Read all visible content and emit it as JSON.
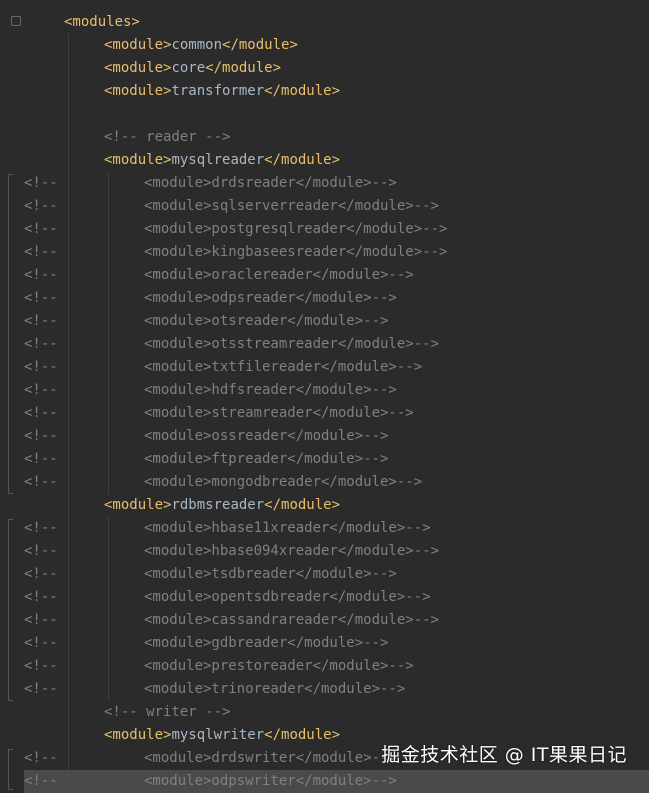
{
  "editor": {
    "lines": [
      {
        "indent": 1,
        "type": "tag",
        "open": "<modules>",
        "name": "",
        "close": ""
      },
      {
        "indent": 2,
        "type": "tag",
        "open": "<module>",
        "name": "common",
        "close": "</module>"
      },
      {
        "indent": 2,
        "type": "tag",
        "open": "<module>",
        "name": "core",
        "close": "</module>"
      },
      {
        "indent": 2,
        "type": "tag",
        "open": "<module>",
        "name": "transformer",
        "close": "</module>"
      },
      {
        "indent": 0,
        "type": "blank"
      },
      {
        "indent": 2,
        "type": "comment",
        "text": "<!-- reader -->"
      },
      {
        "indent": 2,
        "type": "tag",
        "open": "<module>",
        "name": "mysqlreader",
        "close": "</module>"
      },
      {
        "type": "lc",
        "text": "<module>drdsreader</module>-->"
      },
      {
        "type": "lc",
        "text": "<module>sqlserverreader</module>-->"
      },
      {
        "type": "lc",
        "text": "<module>postgresqlreader</module>-->"
      },
      {
        "type": "lc",
        "text": "<module>kingbaseesreader</module>-->"
      },
      {
        "type": "lc",
        "text": "<module>oraclereader</module>-->"
      },
      {
        "type": "lc",
        "text": "<module>odpsreader</module>-->"
      },
      {
        "type": "lc",
        "text": "<module>otsreader</module>-->"
      },
      {
        "type": "lc",
        "text": "<module>otsstreamreader</module>-->"
      },
      {
        "type": "lc",
        "text": "<module>txtfilereader</module>-->"
      },
      {
        "type": "lc",
        "text": "<module>hdfsreader</module>-->"
      },
      {
        "type": "lc",
        "text": "<module>streamreader</module>-->"
      },
      {
        "type": "lc",
        "text": "<module>ossreader</module>-->"
      },
      {
        "type": "lc",
        "text": "<module>ftpreader</module>-->"
      },
      {
        "type": "lc",
        "text": "<module>mongodbreader</module>-->"
      },
      {
        "indent": 2,
        "type": "tag",
        "open": "<module>",
        "name": "rdbmsreader",
        "close": "</module>"
      },
      {
        "type": "lc",
        "text": "<module>hbase11xreader</module>-->"
      },
      {
        "type": "lc",
        "text": "<module>hbase094xreader</module>-->"
      },
      {
        "type": "lc",
        "text": "<module>tsdbreader</module>-->"
      },
      {
        "type": "lc",
        "text": "<module>opentsdbreader</module>-->"
      },
      {
        "type": "lc",
        "text": "<module>cassandrareader</module>-->"
      },
      {
        "type": "lc",
        "text": "<module>gdbreader</module>-->"
      },
      {
        "type": "lc",
        "text": "<module>prestoreader</module>-->"
      },
      {
        "type": "lc",
        "text": "<module>trinoreader</module>-->"
      },
      {
        "indent": 2,
        "type": "comment",
        "text": "<!-- writer -->"
      },
      {
        "indent": 2,
        "type": "tag",
        "open": "<module>",
        "name": "mysqlwriter",
        "close": "</module>"
      },
      {
        "type": "lc",
        "text": "<module>drdswriter</module>-->"
      },
      {
        "type": "lc",
        "text": "<module>odpswriter</module>-->",
        "highlight": true
      }
    ],
    "line_comment_prefix": "<!--"
  },
  "watermark": "掘金技术社区 @ IT果果日记",
  "colors": {
    "background": "#2b2b2b",
    "tag": "#e8bf6a",
    "text": "#a9b7c6",
    "comment": "#808080"
  }
}
